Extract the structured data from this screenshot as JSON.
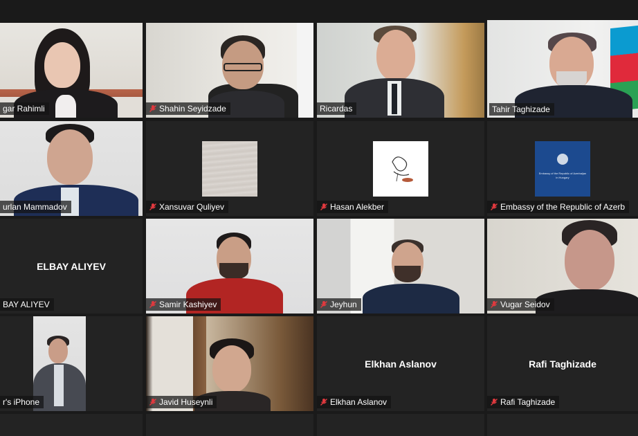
{
  "participants": [
    {
      "name": "gar Rahimli",
      "muted": false
    },
    {
      "name": "Shahin Seyidzade",
      "muted": true
    },
    {
      "name": "Ricardas",
      "muted": false
    },
    {
      "name": "Tahir Taghizade",
      "muted": false
    },
    {
      "name": "urlan Mammadov",
      "muted": false
    },
    {
      "name": "Xansuvar Quliyev",
      "muted": true
    },
    {
      "name": "Hasan Alekber",
      "muted": true
    },
    {
      "name": "Embassy of the Republic of Azerb",
      "muted": true
    },
    {
      "name": "BAY ALIYEV",
      "display_name": "ELBAY ALIYEV",
      "muted": false
    },
    {
      "name": "Samir Kashiyev",
      "muted": true
    },
    {
      "name": "Jeyhun",
      "muted": true
    },
    {
      "name": "Vugar Seidov",
      "muted": true
    },
    {
      "name": "r's iPhone",
      "muted": false
    },
    {
      "name": "Javid Huseynli",
      "muted": true
    },
    {
      "name": "Elkhan Aslanov",
      "display_name": "Elkhan Aslanov",
      "muted": true
    },
    {
      "name": "Rafi Taghizade",
      "display_name": "Rafi Taghizade",
      "muted": true
    }
  ],
  "embassy_avatar_text": [
    "Embassy of the Republic of Azerbaijan",
    "in Hungary"
  ],
  "colors": {
    "active_speaker_border": "#e6d84a",
    "muted_icon": "#e0393e",
    "tile_background": "#232323",
    "page_background": "#1a1a1a"
  }
}
